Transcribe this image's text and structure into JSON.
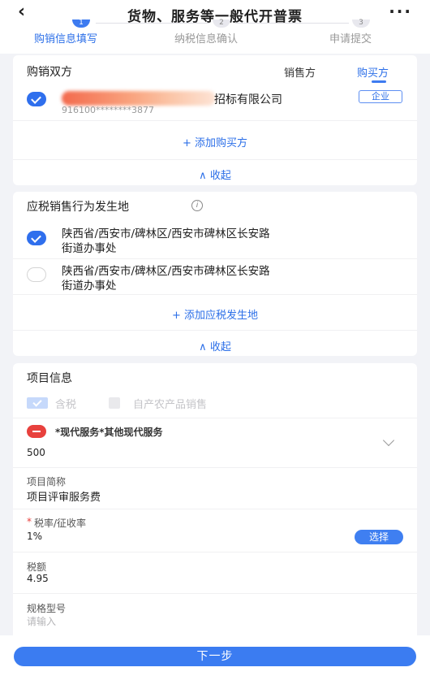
{
  "header": {
    "back_icon": "‹",
    "title": "货物、服务等一般代开普票",
    "more_icon": "···"
  },
  "steps": [
    {
      "number": "1",
      "label": "购销信息填写"
    },
    {
      "number": "2",
      "label": "纳税信息确认"
    },
    {
      "number": "3",
      "label": "申请提交"
    }
  ],
  "parties": {
    "title": "购销双方",
    "tab_seller": "销售方",
    "tab_buyer": "购买方",
    "buyer": {
      "name_suffix": "招标有限公司",
      "tax_id": "916100********3877",
      "type_badge": "企业"
    },
    "add_buyer": "+ 添加购买方",
    "collapse": "∧ 收起"
  },
  "location": {
    "title": "应税销售行为发生地",
    "info_icon": "i",
    "options": [
      {
        "line1": "陕西省/西安市/碑林区/西安市碑林区长安路",
        "line2": "街道办事处",
        "selected": true
      },
      {
        "line1": "陕西省/西安市/碑林区/西安市碑林区长安路",
        "line2": "街道办事处",
        "selected": false
      }
    ],
    "add_location": "+ 添加应税发生地",
    "collapse": "∧ 收起"
  },
  "project": {
    "title": "项目信息",
    "tax_included_label": "含税",
    "agri_label": "自产农产品销售",
    "item_name": "*现代服务*其他现代服务",
    "amount": "500",
    "short_name_label": "项目简称",
    "short_name_value": "项目评审服务费",
    "rate_required_mark": "*",
    "rate_label": "税率/征收率",
    "rate_value": "1%",
    "select_button": "选择",
    "tax_amount_label": "税额",
    "tax_amount_value": "4.95",
    "spec_label": "规格型号",
    "spec_placeholder": "请输入"
  },
  "footer": {
    "next_button": "下一步"
  },
  "colors": {
    "accent": "#3d7bf0",
    "danger": "#e8413d",
    "background": "#f2f3f7"
  }
}
